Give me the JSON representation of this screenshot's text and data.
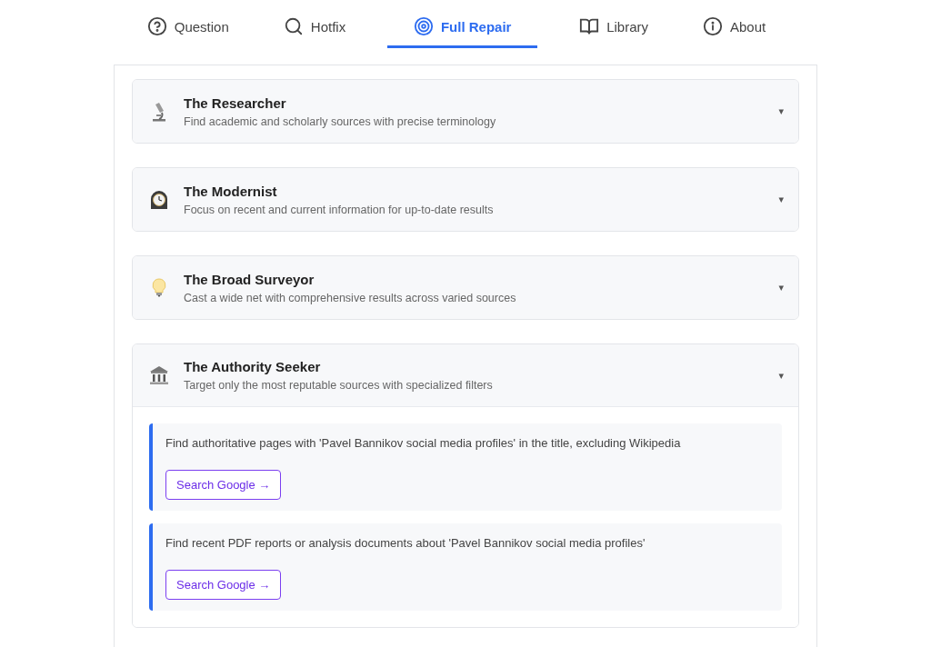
{
  "tabs": [
    {
      "label": "Question",
      "kind": "question",
      "selected": false
    },
    {
      "label": "Hotfix",
      "kind": "search",
      "selected": false
    },
    {
      "label": "Full Repair",
      "kind": "target",
      "selected": true
    },
    {
      "label": "Library",
      "kind": "book",
      "selected": false
    },
    {
      "label": "About",
      "kind": "info",
      "selected": false
    }
  ],
  "personas": [
    {
      "kind": "microscope",
      "title": "The Researcher",
      "description": "Find academic and scholarly sources with precise terminology",
      "toggle": "▾",
      "expanded": false
    },
    {
      "kind": "clock",
      "title": "The Modernist",
      "description": "Focus on recent and current information for up-to-date results",
      "toggle": "▾",
      "expanded": false
    },
    {
      "kind": "bulb",
      "title": "The Broad Surveyor",
      "description": "Cast a wide net with comprehensive results across varied sources",
      "toggle": "▾",
      "expanded": false
    },
    {
      "kind": "building",
      "title": "The Authority Seeker",
      "description": "Target only the most reputable sources with specialized filters",
      "toggle": "▾",
      "expanded": true,
      "queries": [
        {
          "text": "Find authoritative pages with 'Pavel Bannikov social media profiles' in the title, excluding Wikipedia",
          "button": "Search Google →"
        },
        {
          "text": "Find recent PDF reports or analysis documents about 'Pavel Bannikov social media profiles'",
          "button": "Search Google →"
        }
      ]
    }
  ]
}
